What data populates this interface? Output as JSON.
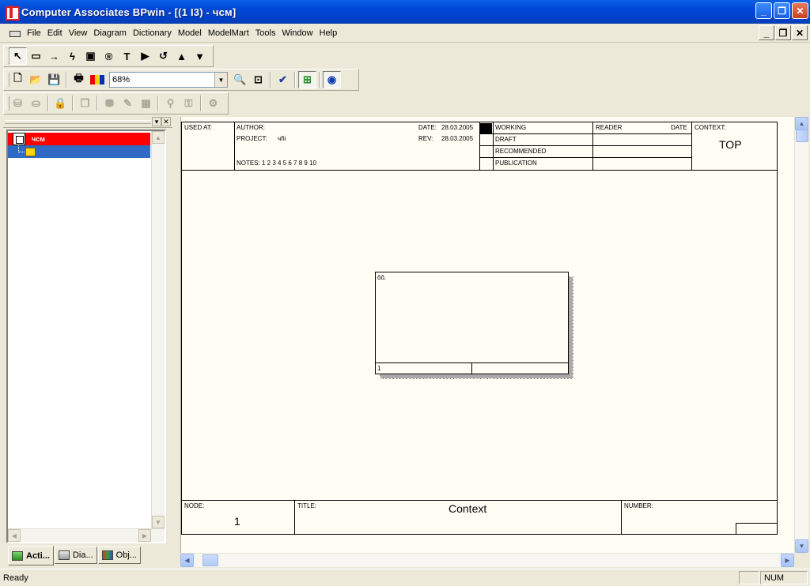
{
  "window": {
    "title": "Computer Associates BPwin - [(1 I3)  - чсм]",
    "minimize_icon": "minimize-icon",
    "restore_icon": "restore-icon",
    "close_icon": "close-icon"
  },
  "menu": {
    "items": [
      "File",
      "Edit",
      "View",
      "Diagram",
      "Dictionary",
      "Model",
      "ModelMart",
      "Tools",
      "Window",
      "Help"
    ]
  },
  "toolbar": {
    "zoom_value": "68%",
    "zoom_dropdown_icon": "▼"
  },
  "tree": {
    "root_label": "чсм",
    "child_label": ""
  },
  "tabs": [
    "Acti...",
    "Dia...",
    "Obj..."
  ],
  "diagram": {
    "header": {
      "used_at": "USED AT:",
      "author": "AUTHOR:",
      "project": "PROJECT:",
      "project_value": "чñі",
      "date_label": "DATE:",
      "date_value": "28.03.2005",
      "rev_label": "REV:",
      "rev_value": "28.03.2005",
      "notes": "NOTES:  1  2  3  4  5  6  7  8  9  10",
      "status": [
        "WORKING",
        "DRAFT",
        "RECOMMENDED",
        "PUBLICATION"
      ],
      "reader": "READER",
      "date": "DATE",
      "context_label": "CONTEXT:",
      "context_value": "TOP"
    },
    "box": {
      "name": "ôô.",
      "number": "1"
    },
    "footer": {
      "node_label": "NODE:",
      "node_value": "1",
      "title_label": "TITLE:",
      "title_value": "Context",
      "number_label": "NUMBER:"
    }
  },
  "status": {
    "text": "Ready",
    "num": "NUM"
  }
}
